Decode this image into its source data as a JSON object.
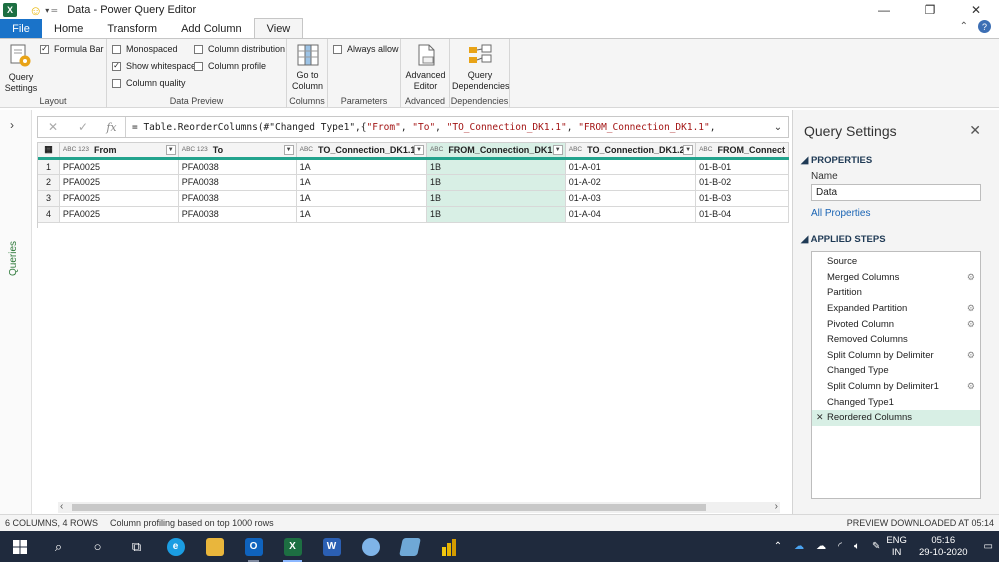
{
  "app": {
    "title": "Data - Power Query Editor",
    "logo": "X",
    "win_minimize": "—",
    "win_restore": "❐",
    "win_close": "✕"
  },
  "tabs": [
    {
      "label": "File"
    },
    {
      "label": "Home"
    },
    {
      "label": "Transform"
    },
    {
      "label": "Add Column"
    },
    {
      "label": "View"
    }
  ],
  "ribbon": {
    "layout": {
      "query_settings": "Query Settings",
      "formula_bar": "Formula Bar",
      "group_label": "Layout"
    },
    "data_preview": {
      "monospaced": "Monospaced",
      "show_whitespace": "Show whitespace",
      "column_quality": "Column quality",
      "column_distribution": "Column distribution",
      "column_profile": "Column profile",
      "group_label": "Data Preview"
    },
    "columns": {
      "go_to_column": "Go to Column",
      "group_label": "Columns"
    },
    "parameters": {
      "always_allow": "Always allow",
      "group_label": "Parameters"
    },
    "advanced": {
      "advanced_editor": "Advanced Editor",
      "group_label": "Advanced"
    },
    "dependencies": {
      "query_dependencies": "Query Dependencies",
      "group_label": "Dependencies"
    }
  },
  "left_panel": {
    "label": "Queries"
  },
  "formula": {
    "prefix": "= Table.ReorderColumns(#\"Changed Type1\",{",
    "s1": "\"From\"",
    "s2": "\"To\"",
    "s3": "\"TO_Connection_DK1.1\"",
    "s4": "\"FROM_Connection_DK1.1\"",
    "sep": ", ",
    "tail": ","
  },
  "grid": {
    "columns": [
      {
        "type": "ABC 123",
        "name": "From"
      },
      {
        "type": "ABC 123",
        "name": "To"
      },
      {
        "type": "ABC",
        "name": "TO_Connection_DK1.1"
      },
      {
        "type": "ABC",
        "name": "FROM_Connection_DK1.1"
      },
      {
        "type": "ABC",
        "name": "TO_Connection_DK1.2"
      },
      {
        "type": "ABC",
        "name": "FROM_Connect"
      }
    ],
    "rows": [
      {
        "idx": "1",
        "cells": [
          "PFA0025",
          "PFA0038",
          "1A",
          "1B",
          "01-A-01",
          "01-B-01"
        ]
      },
      {
        "idx": "2",
        "cells": [
          "PFA0025",
          "PFA0038",
          "1A",
          "1B",
          "01-A-02",
          "01-B-02"
        ]
      },
      {
        "idx": "3",
        "cells": [
          "PFA0025",
          "PFA0038",
          "1A",
          "1B",
          "01-A-03",
          "01-B-03"
        ]
      },
      {
        "idx": "4",
        "cells": [
          "PFA0025",
          "PFA0038",
          "1A",
          "1B",
          "01-A-04",
          "01-B-04"
        ]
      }
    ]
  },
  "query_settings": {
    "title": "Query Settings",
    "properties_heading": "PROPERTIES",
    "name_label": "Name",
    "name_value": "Data",
    "all_properties": "All Properties",
    "applied_steps_heading": "APPLIED STEPS",
    "steps": [
      {
        "label": "Source",
        "gear": false
      },
      {
        "label": "Merged Columns",
        "gear": true
      },
      {
        "label": "Partition",
        "gear": false
      },
      {
        "label": "Expanded Partition",
        "gear": true
      },
      {
        "label": "Pivoted Column",
        "gear": true
      },
      {
        "label": "Removed Columns",
        "gear": false
      },
      {
        "label": "Split Column by Delimiter",
        "gear": true
      },
      {
        "label": "Changed Type",
        "gear": false
      },
      {
        "label": "Split Column by Delimiter1",
        "gear": true
      },
      {
        "label": "Changed Type1",
        "gear": false
      },
      {
        "label": "Reordered Columns",
        "gear": false,
        "active": true
      }
    ]
  },
  "status": {
    "counts": "6 COLUMNS, 4 ROWS",
    "profiling": "Column profiling based on top 1000 rows",
    "preview": "PREVIEW DOWNLOADED AT 05:14"
  },
  "taskbar": {
    "lang_top": "ENG",
    "lang_bottom": "IN",
    "time": "05:16",
    "date": "29-10-2020"
  },
  "colors": {
    "accent_teal": "#23a38d",
    "selected_fill": "#d8efe5",
    "file_tab": "#1a73c9",
    "taskbar": "#1f2a3d"
  }
}
